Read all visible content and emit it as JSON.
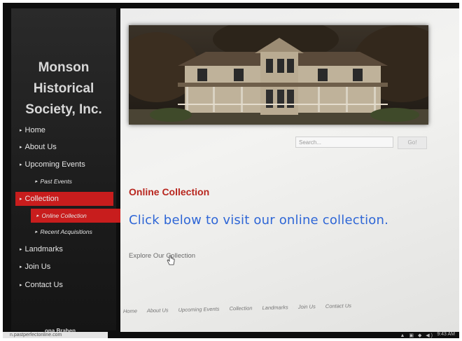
{
  "site": {
    "title_lines": [
      "Monson",
      "Historical",
      "Society, Inc."
    ]
  },
  "nav": {
    "items": [
      {
        "label": "Home"
      },
      {
        "label": "About Us"
      },
      {
        "label": "Upcoming Events"
      },
      {
        "label": "Past Events"
      },
      {
        "label": "Collection"
      },
      {
        "label": "Online Collection"
      },
      {
        "label": "Recent Acquisitions"
      },
      {
        "label": "Landmarks"
      },
      {
        "label": "Join Us"
      },
      {
        "label": "Contact Us"
      }
    ]
  },
  "search": {
    "placeholder": "Search...",
    "go_label": "Go!"
  },
  "main": {
    "heading": "Online Collection",
    "visit_text": "Click below to visit our online collection.",
    "explore_link": "Explore Our Collection"
  },
  "footer": {
    "links": [
      "Home",
      "About Us",
      "Upcoming Events",
      "Collection",
      "Landmarks",
      "Join Us",
      "Contact Us"
    ],
    "name": "ona Brahen"
  },
  "status": {
    "url": "n.pastperfectonline.com",
    "clock": "9:43 AM"
  },
  "colors": {
    "accent": "#c81d1d",
    "heading": "#b8261e",
    "link_blue": "#2e66d6"
  }
}
